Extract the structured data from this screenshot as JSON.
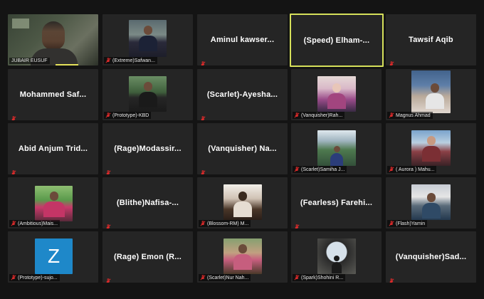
{
  "meeting": {
    "participants": [
      {
        "id": "p1",
        "label": "JUBAIR EUSUF",
        "display_name": null,
        "muted": false,
        "has_video": true,
        "active_speaker": false
      },
      {
        "id": "p2",
        "label": "(Extreme)Safwan...",
        "display_name": null,
        "muted": true,
        "has_video": true
      },
      {
        "id": "p3",
        "label": null,
        "display_name": "Aminul  kawser...",
        "muted": true,
        "has_video": false
      },
      {
        "id": "p4",
        "label": null,
        "display_name": "(Speed)  Elham-...",
        "muted": false,
        "has_video": false,
        "active_speaker": true
      },
      {
        "id": "p5",
        "label": null,
        "display_name": "Tawsif Aqib",
        "muted": true,
        "has_video": false
      },
      {
        "id": "p6",
        "label": null,
        "display_name": "Mohammed  Saf...",
        "muted": true,
        "has_video": false
      },
      {
        "id": "p7",
        "label": "(Prototype)-KBD",
        "display_name": null,
        "muted": true,
        "has_video": true
      },
      {
        "id": "p8",
        "label": null,
        "display_name": "(Scarlet)-Ayesha...",
        "muted": true,
        "has_video": false
      },
      {
        "id": "p9",
        "label": "(Vanquisher)Rah...",
        "display_name": null,
        "muted": true,
        "has_video": true
      },
      {
        "id": "p10",
        "label": "Magnus Ahmad",
        "display_name": null,
        "muted": true,
        "has_video": true
      },
      {
        "id": "p11",
        "label": null,
        "display_name": "Abid Anjum Trid...",
        "muted": true,
        "has_video": false
      },
      {
        "id": "p12",
        "label": null,
        "display_name": "(Rage)Modassir...",
        "muted": true,
        "has_video": false
      },
      {
        "id": "p13",
        "label": null,
        "display_name": "(Vanquisher)  Na...",
        "muted": true,
        "has_video": false
      },
      {
        "id": "p14",
        "label": "(Scarlet)Samiha J...",
        "display_name": null,
        "muted": true,
        "has_video": true
      },
      {
        "id": "p15",
        "label": "( Aurora ) Mahu...",
        "display_name": null,
        "muted": true,
        "has_video": true
      },
      {
        "id": "p16",
        "label": "(Ambitious)Mais...",
        "display_name": null,
        "muted": true,
        "has_video": true
      },
      {
        "id": "p17",
        "label": null,
        "display_name": "(Blithe)Nafisa-...",
        "muted": true,
        "has_video": false
      },
      {
        "id": "p18",
        "label": "(Blossom-RM)  M...",
        "display_name": null,
        "muted": true,
        "has_video": true
      },
      {
        "id": "p19",
        "label": null,
        "display_name": "(Fearless)  Farehi...",
        "muted": true,
        "has_video": false
      },
      {
        "id": "p20",
        "label": "(Flash)Yamin",
        "display_name": null,
        "muted": true,
        "has_video": true
      },
      {
        "id": "p21",
        "label": "(Prototype)-sujo...",
        "display_name": null,
        "muted": true,
        "has_video": true,
        "avatar_letter": "Z"
      },
      {
        "id": "p22",
        "label": null,
        "display_name": "(Rage)  Emon  (R...",
        "muted": true,
        "has_video": false
      },
      {
        "id": "p23",
        "label": "(Scarlet)Nur Nah...",
        "display_name": null,
        "muted": true,
        "has_video": true
      },
      {
        "id": "p24",
        "label": "(Spark)Shohini R...",
        "display_name": null,
        "muted": true,
        "has_video": true
      },
      {
        "id": "p25",
        "label": null,
        "display_name": "(Vanquisher)Sad...",
        "muted": true,
        "has_video": false
      }
    ]
  },
  "colors": {
    "background": "#141414",
    "tile": "#252525",
    "active_border": "#d6e05a",
    "mute_icon": "#e02b2b"
  },
  "icons": {
    "muted": "mic-off-icon"
  }
}
